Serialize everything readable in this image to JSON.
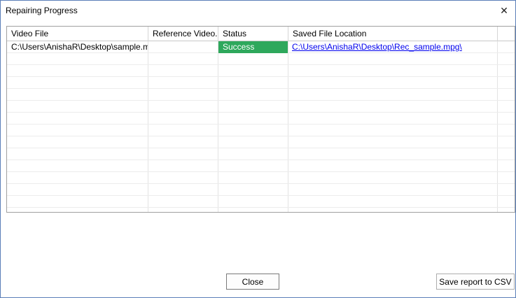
{
  "window": {
    "title": "Repairing Progress",
    "close_glyph": "✕"
  },
  "table": {
    "columns": [
      "Video File",
      "Reference Video...",
      "Status",
      "Saved File Location"
    ],
    "rows": [
      {
        "video_file": "C:\\Users\\AnishaR\\Desktop\\sample.mpg",
        "reference_video": "",
        "status": "Success",
        "saved_location": "C:\\Users\\AnishaR\\Desktop\\Rec_sample.mpg\\"
      }
    ],
    "status_color": "#2ea85c",
    "link_color": "#0000ee"
  },
  "buttons": {
    "close_label": "Close",
    "save_label": "Save report to CSV"
  }
}
